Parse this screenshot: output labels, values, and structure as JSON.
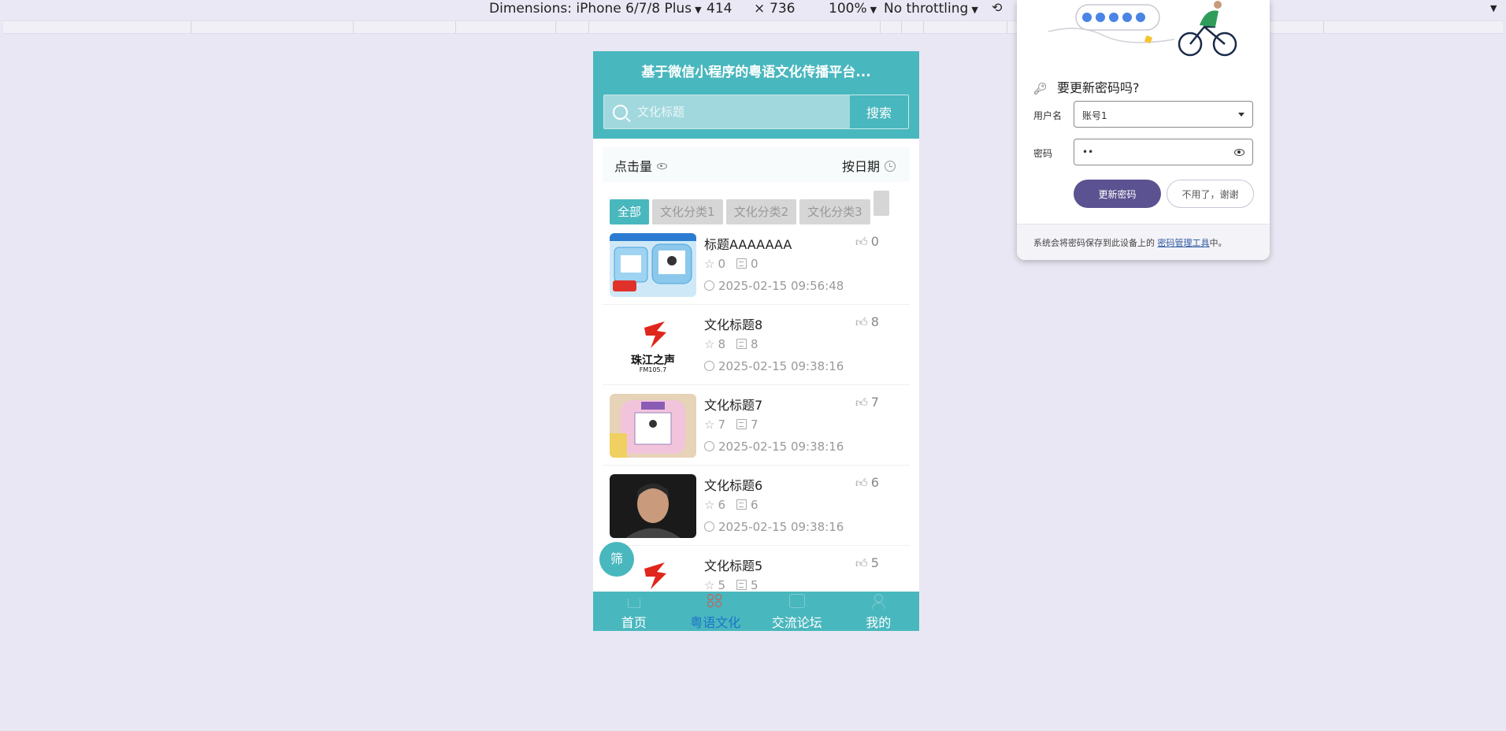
{
  "devtools": {
    "device": "Dimensions: iPhone 6/7/8 Plus",
    "width": "414",
    "times": "×",
    "height": "736",
    "zoom": "100%",
    "throttling": "No throttling"
  },
  "app": {
    "title": "基于微信小程序的粤语文化传播平台...",
    "search": {
      "placeholder": "文化标题",
      "button": "搜索"
    },
    "sort": {
      "left": "点击量",
      "right": "按日期"
    },
    "tabs": [
      "全部",
      "文化分类1",
      "文化分类2",
      "文化分类3"
    ],
    "items": [
      {
        "title": "标题AAAAAAA",
        "likes": "0",
        "favorites": "0",
        "comments": "0",
        "date": "2025-02-15 09:56:48",
        "thumb": "product-blue"
      },
      {
        "title": "文化标题8",
        "likes": "8",
        "favorites": "8",
        "comments": "8",
        "date": "2025-02-15 09:38:16",
        "thumb": "logo"
      },
      {
        "title": "文化标题7",
        "likes": "7",
        "favorites": "7",
        "comments": "7",
        "date": "2025-02-15 09:38:16",
        "thumb": "product-pink"
      },
      {
        "title": "文化标题6",
        "likes": "6",
        "favorites": "6",
        "comments": "6",
        "date": "2025-02-15 09:38:16",
        "thumb": "portrait"
      },
      {
        "title": "文化标题5",
        "likes": "5",
        "favorites": "5",
        "comments": "5",
        "date": "",
        "thumb": "logo"
      }
    ],
    "logo_text": "珠江之声",
    "logo_sub": "FM105.7",
    "filter_button": "筛",
    "tabbar": [
      {
        "label": "首页",
        "icon": "home-icon"
      },
      {
        "label": "粤语文化",
        "icon": "grid-icon",
        "active": true
      },
      {
        "label": "交流论坛",
        "icon": "chat-icon"
      },
      {
        "label": "我的",
        "icon": "user-icon"
      }
    ]
  },
  "password_popup": {
    "heading": "要更新密码吗?",
    "username_label": "用户名",
    "username_value": "账号1",
    "password_label": "密码",
    "password_value": "••",
    "update_button": "更新密码",
    "dismiss_button": "不用了，谢谢",
    "footer_text": "系统会将密码保存到此设备上的",
    "footer_link": "密码管理工具",
    "footer_suffix": "中。",
    "accent_color": "#5b5291"
  }
}
